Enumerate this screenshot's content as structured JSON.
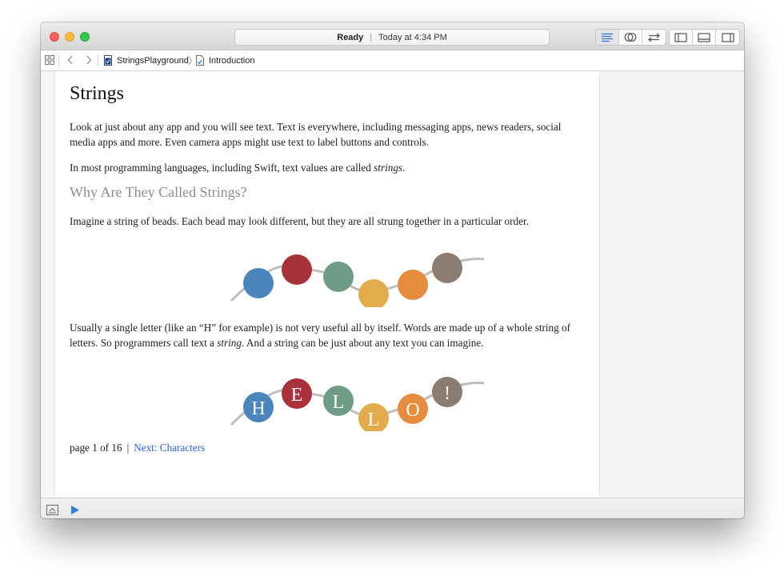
{
  "window": {
    "activity_status": "Ready",
    "activity_time": "Today at 4:34 PM"
  },
  "toolbar": {
    "editor_icons": [
      "standard-editor-icon",
      "assistant-editor-icon",
      "version-editor-icon"
    ],
    "view_icons": [
      "navigator-toggle-icon",
      "debug-area-toggle-icon",
      "utilities-toggle-icon"
    ]
  },
  "jumpbar": {
    "playground_name": "StringsPlayground",
    "page_name": "Introduction"
  },
  "doc": {
    "title": "Strings",
    "para1": "Look at just about any app and you will see text. Text is everywhere, including messaging apps, news readers, social media apps and more. Even camera apps might use text to label buttons and controls.",
    "para2_before": "In most programming languages, including Swift, text values are called ",
    "para2_em": "strings",
    "para2_after": ".",
    "heading": "Why Are They Called Strings?",
    "para3": "Imagine a string of beads. Each bead may look different, but they are all strung together in a particular order.",
    "para4_before": "Usually a single letter (like an “H” for example) is not very useful all by itself. Words are made up of a whole string of letters. So programmers call text a ",
    "para4_em": "string",
    "para4_after": ". And a string can be just about any text you can imagine.",
    "pager_text": "page 1 of 16",
    "pager_sep": "|",
    "next_link": "Next: Characters"
  },
  "beads": {
    "colors": [
      "#4a86bd",
      "#a8313a",
      "#6f9c86",
      "#e2ac4c",
      "#e58c3f",
      "#8c7b70"
    ],
    "letters": [
      "H",
      "E",
      "L",
      "L",
      "O",
      "!"
    ],
    "string_color": "#bdbdbd"
  }
}
